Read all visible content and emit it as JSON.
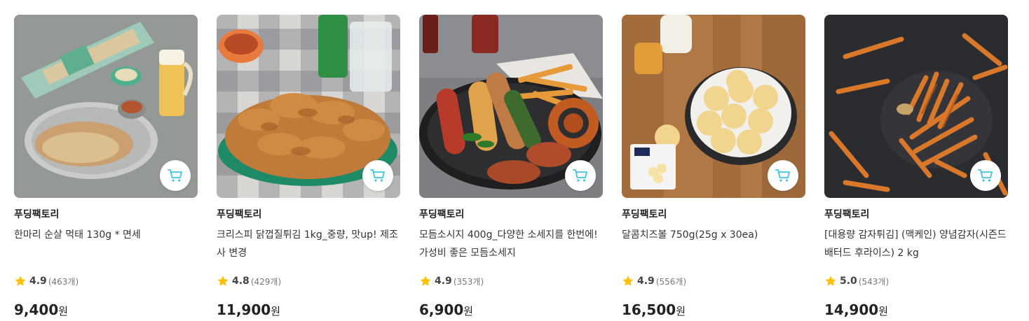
{
  "colors": {
    "accent": "#3ec6e0",
    "star": "#ffc107"
  },
  "products": [
    {
      "brand": "푸딩팩토리",
      "name": "한마리 순살 먹태 130g * 면세",
      "rating": "4.9",
      "count": "(463개)",
      "price": "9,400",
      "currency": "원",
      "icon": "cart-icon"
    },
    {
      "brand": "푸딩팩토리",
      "name": "크리스피 닭껍질튀김 1kg_중량, 맛up! 제조사 변경",
      "rating": "4.8",
      "count": "(429개)",
      "price": "11,900",
      "currency": "원",
      "icon": "cart-icon"
    },
    {
      "brand": "푸딩팩토리",
      "name": "모듬소시지 400g_다양한 소세지를 한번에! 가성비 좋은 모듬소세지",
      "rating": "4.9",
      "count": "(353개)",
      "price": "6,900",
      "currency": "원",
      "icon": "cart-icon"
    },
    {
      "brand": "푸딩팩토리",
      "name": "달콤치즈볼 750g(25g x 30ea)",
      "rating": "4.9",
      "count": "(556개)",
      "price": "16,500",
      "currency": "원",
      "icon": "cart-icon"
    },
    {
      "brand": "푸딩팩토리",
      "name": "[대용량 감자튀김] (맥케인) 양념감자(시즌드 배터드 후라이스) 2 kg",
      "rating": "5.0",
      "count": "(543개)",
      "price": "14,900",
      "currency": "원",
      "icon": "cart-icon"
    }
  ]
}
